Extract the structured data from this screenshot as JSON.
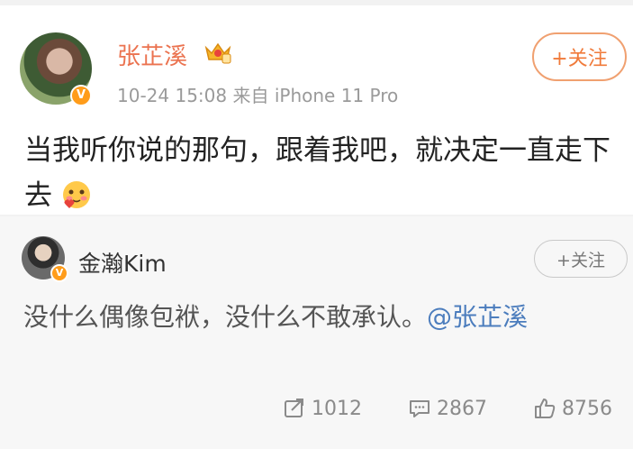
{
  "post": {
    "author": "张芷溪",
    "meta": "10-24 15:08  来自 iPhone 11 Pro",
    "follow_label": "+关注",
    "text": "当我听你说的那句，跟着我吧，就决定一直走下去",
    "verified_badge": "V",
    "level_badge_icon": "crown-icon",
    "emoji_icon": "blush-emoji-icon"
  },
  "retweet": {
    "author": "金瀚Kim",
    "follow_label": "+关注",
    "text": "没什么偶像包袱，没什么不敢承认。",
    "mention": "@张芷溪",
    "verified_badge": "V",
    "actions": [
      {
        "icon": "share-icon",
        "count": "1012"
      },
      {
        "icon": "comment-icon",
        "count": "2867"
      },
      {
        "icon": "like-icon",
        "count": "8756"
      }
    ]
  },
  "colors": {
    "author_orange": "#eb7350",
    "mention_blue": "#4c7dbd",
    "badge_orange": "#ff9c1a"
  }
}
